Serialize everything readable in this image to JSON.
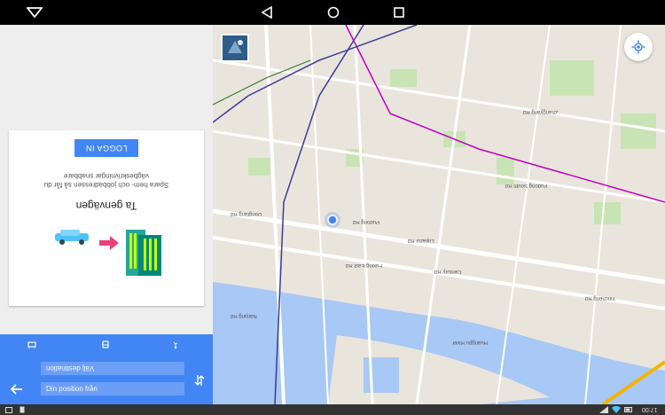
{
  "nav": {
    "back_icon": "back-triangle-icon",
    "home_icon": "home-circle-icon",
    "recents_icon": "recents-square-icon",
    "dropdown_icon": "nav-dropdown-icon"
  },
  "card": {
    "button_label": "LOGGA IN",
    "body_text": "Spara hem- och jobbadressen så får du vägbeskrivningar snabbare",
    "title": "Ta genvägen"
  },
  "directions": {
    "origin_value": "Din position",
    "origin_prefix": "från",
    "destination_placeholder": "Välj destination",
    "modes": [
      "walk-icon",
      "transit-icon",
      "car-icon"
    ]
  },
  "map": {
    "labels": [
      "Pudong Rd",
      "Century Rd",
      "Dongfang Rd",
      "Lujiazui Rd",
      "Yincheng Rd",
      "Pudong South Rd",
      "Huangpu River",
      "Fuxing East Rd",
      "Zhangyang Rd",
      "Nanjing Rd"
    ]
  },
  "status": {
    "time": "17:00"
  },
  "colors": {
    "accent": "#4285f4",
    "water": "#a8c8f5",
    "park": "#c8e3b4",
    "road": "#ffffff",
    "highway": "#f4b400"
  }
}
